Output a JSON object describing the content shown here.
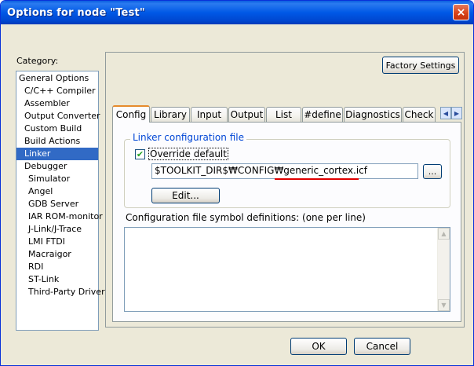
{
  "window": {
    "title": "Options for node \"Test\"",
    "close_glyph": "×"
  },
  "category": {
    "label": "Category:",
    "items": [
      {
        "label": "General Options",
        "level": 0
      },
      {
        "label": "C/C++ Compiler",
        "level": 1
      },
      {
        "label": "Assembler",
        "level": 1
      },
      {
        "label": "Output Converter",
        "level": 1
      },
      {
        "label": "Custom Build",
        "level": 1
      },
      {
        "label": "Build Actions",
        "level": 1
      },
      {
        "label": "Linker",
        "level": 1,
        "selected": true
      },
      {
        "label": "Debugger",
        "level": 1
      },
      {
        "label": "Simulator",
        "level": 2
      },
      {
        "label": "Angel",
        "level": 2
      },
      {
        "label": "GDB Server",
        "level": 2
      },
      {
        "label": "IAR ROM-monitor",
        "level": 2
      },
      {
        "label": "J-Link/J-Trace",
        "level": 2
      },
      {
        "label": "LMI FTDI",
        "level": 2
      },
      {
        "label": "Macraigor",
        "level": 2
      },
      {
        "label": "RDI",
        "level": 2
      },
      {
        "label": "ST-Link",
        "level": 2
      },
      {
        "label": "Third-Party Driver",
        "level": 2
      }
    ]
  },
  "toolbar": {
    "factory_settings_label": "Factory Settings"
  },
  "tabs": [
    {
      "label": "Config",
      "active": true
    },
    {
      "label": "Library"
    },
    {
      "label": "Input"
    },
    {
      "label": "Output"
    },
    {
      "label": "List"
    },
    {
      "label": "#define"
    },
    {
      "label": "Diagnostics"
    },
    {
      "label": "Check"
    }
  ],
  "tab_scroll": {
    "left": "◀",
    "right": "▶"
  },
  "config": {
    "group_title": "Linker configuration file",
    "override_label": "Override default",
    "override_checked": true,
    "check_glyph": "✔",
    "path_value": "$TOOLKIT_DIR$₩CONFIG₩generic_cortex.icf",
    "browse_label": "...",
    "edit_label": "Edit...",
    "symbols_label": "Configuration file symbol definitions: (one per line)",
    "symbols_value": "",
    "scroll_up": "▲",
    "scroll_down": "▼"
  },
  "dialog": {
    "ok_label": "OK",
    "cancel_label": "Cancel"
  },
  "colors": {
    "accent_selection": "#316ac5",
    "group_title": "#0046d5",
    "highlight_underline": "#e00000"
  }
}
